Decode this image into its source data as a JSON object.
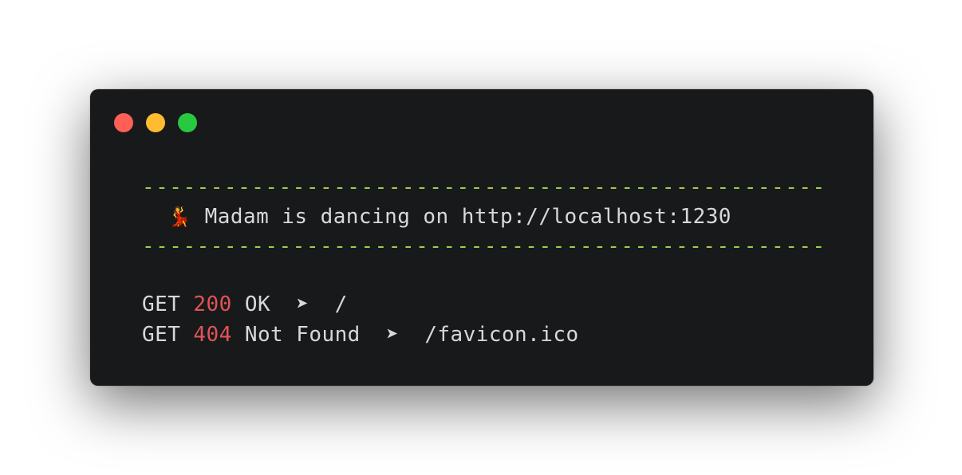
{
  "window": {
    "controls": [
      {
        "name": "close",
        "color": "#fe5f57"
      },
      {
        "name": "minimize",
        "color": "#febc2e"
      },
      {
        "name": "zoom",
        "color": "#28c840"
      }
    ]
  },
  "terminal": {
    "separator": "--------------------------------------------------",
    "banner_emoji": "💃",
    "banner_text": " Madam is dancing on http://localhost:1230",
    "requests": [
      {
        "method": "GET",
        "status": "200",
        "message": "OK",
        "arrow": "➤",
        "path": "/"
      },
      {
        "method": "GET",
        "status": "404",
        "message": "Not Found",
        "arrow": "➤",
        "path": "/favicon.ico"
      }
    ]
  },
  "colors": {
    "background": "#18191b",
    "text": "#d8d8d8",
    "separator": "#9acd50",
    "status": "#e05457"
  }
}
